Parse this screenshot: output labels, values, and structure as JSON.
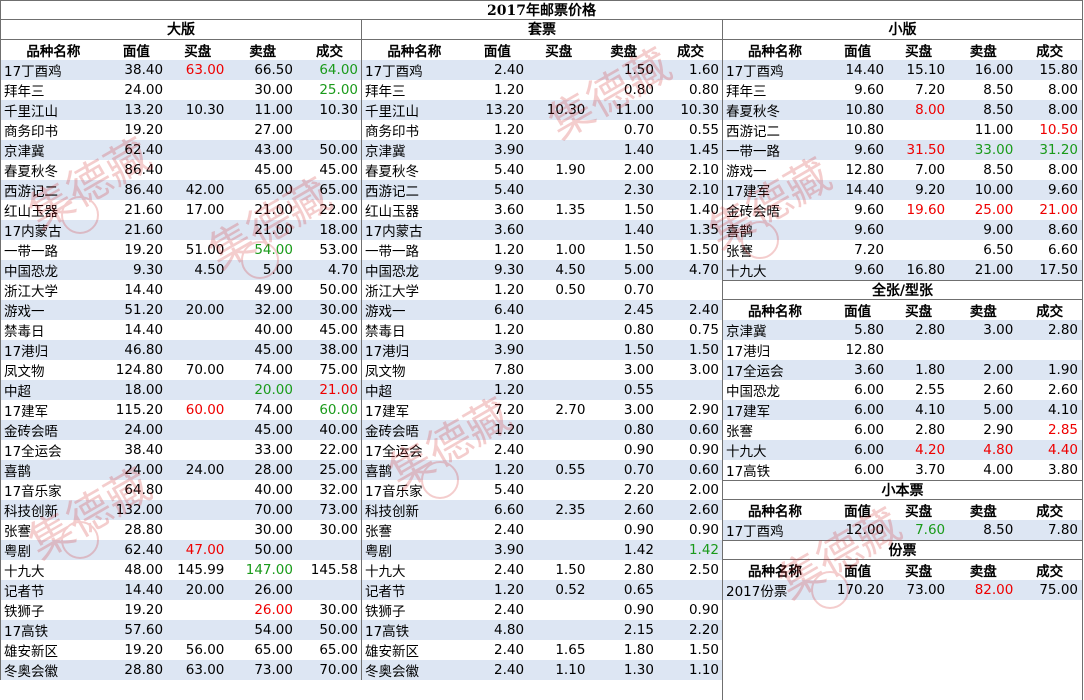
{
  "title": "2017年邮票价格",
  "headers": [
    "品种名称",
    "面值",
    "买盘",
    "卖盘",
    "成交"
  ],
  "watermark": "集德藏",
  "colors": {
    "stripe": "#dde6f3",
    "red": "#ee0000",
    "green": "#1a9a1a",
    "border": "#6f6f6f"
  },
  "sections": {
    "daban": {
      "title": "大版",
      "rows": [
        {
          "name": "17丁酉鸡",
          "face": "38.40",
          "bid": "63.00",
          "ask": "66.50",
          "deal": "64.00",
          "bidColor": "red",
          "dealColor": "green"
        },
        {
          "name": "拜年三",
          "face": "24.00",
          "bid": "",
          "ask": "30.00",
          "deal": "25.00",
          "dealColor": "green"
        },
        {
          "name": "千里江山",
          "face": "13.20",
          "bid": "10.30",
          "ask": "11.00",
          "deal": "10.30"
        },
        {
          "name": "商务印书",
          "face": "19.20",
          "bid": "",
          "ask": "27.00",
          "deal": ""
        },
        {
          "name": "京津冀",
          "face": "62.40",
          "bid": "",
          "ask": "43.00",
          "deal": "50.00"
        },
        {
          "name": "春夏秋冬",
          "face": "86.40",
          "bid": "",
          "ask": "45.00",
          "deal": "45.00"
        },
        {
          "name": "西游记二",
          "face": "86.40",
          "bid": "42.00",
          "ask": "65.00",
          "deal": "65.00"
        },
        {
          "name": "红山玉器",
          "face": "21.60",
          "bid": "17.00",
          "ask": "21.00",
          "deal": "22.00"
        },
        {
          "name": "17内蒙古",
          "face": "21.60",
          "bid": "",
          "ask": "21.00",
          "deal": "18.00"
        },
        {
          "name": "一带一路",
          "face": "19.20",
          "bid": "51.00",
          "ask": "54.00",
          "deal": "53.00",
          "askColor": "green"
        },
        {
          "name": "中国恐龙",
          "face": "9.30",
          "bid": "4.50",
          "ask": "5.00",
          "deal": "4.70"
        },
        {
          "name": "浙江大学",
          "face": "14.40",
          "bid": "",
          "ask": "49.00",
          "deal": "50.00"
        },
        {
          "name": "游戏一",
          "face": "51.20",
          "bid": "20.00",
          "ask": "32.00",
          "deal": "30.00"
        },
        {
          "name": "禁毒日",
          "face": "14.40",
          "bid": "",
          "ask": "40.00",
          "deal": "45.00"
        },
        {
          "name": "17港归",
          "face": "46.80",
          "bid": "",
          "ask": "45.00",
          "deal": "38.00"
        },
        {
          "name": "凤文物",
          "face": "124.80",
          "bid": "70.00",
          "ask": "74.00",
          "deal": "75.00"
        },
        {
          "name": "中超",
          "face": "18.00",
          "bid": "",
          "ask": "20.00",
          "deal": "21.00",
          "askColor": "green",
          "dealColor": "red"
        },
        {
          "name": "17建军",
          "face": "115.20",
          "bid": "60.00",
          "ask": "74.00",
          "deal": "60.00",
          "bidColor": "red",
          "dealColor": "green"
        },
        {
          "name": "金砖会晤",
          "face": "24.00",
          "bid": "",
          "ask": "45.00",
          "deal": "40.00"
        },
        {
          "name": "17全运会",
          "face": "38.40",
          "bid": "",
          "ask": "33.00",
          "deal": "22.00"
        },
        {
          "name": "喜鹊",
          "face": "24.00",
          "bid": "24.00",
          "ask": "28.00",
          "deal": "25.00"
        },
        {
          "name": "17音乐家",
          "face": "64.80",
          "bid": "",
          "ask": "40.00",
          "deal": "32.00"
        },
        {
          "name": "科技创新",
          "face": "132.00",
          "bid": "",
          "ask": "70.00",
          "deal": "73.00"
        },
        {
          "name": "张謇",
          "face": "28.80",
          "bid": "",
          "ask": "30.00",
          "deal": "30.00"
        },
        {
          "name": "粤剧",
          "face": "62.40",
          "bid": "47.00",
          "ask": "50.00",
          "deal": "",
          "bidColor": "red"
        },
        {
          "name": "十九大",
          "face": "48.00",
          "bid": "145.99",
          "ask": "147.00",
          "deal": "145.58",
          "askColor": "green"
        },
        {
          "name": "记者节",
          "face": "14.40",
          "bid": "20.00",
          "ask": "26.00",
          "deal": ""
        },
        {
          "name": "铁狮子",
          "face": "19.20",
          "bid": "",
          "ask": "26.00",
          "deal": "30.00",
          "askColor": "red"
        },
        {
          "name": "17高铁",
          "face": "57.60",
          "bid": "",
          "ask": "54.00",
          "deal": "50.00"
        },
        {
          "name": "雄安新区",
          "face": "19.20",
          "bid": "56.00",
          "ask": "65.00",
          "deal": "65.00"
        },
        {
          "name": "冬奥会徽",
          "face": "28.80",
          "bid": "63.00",
          "ask": "73.00",
          "deal": "70.00"
        }
      ]
    },
    "taopiao": {
      "title": "套票",
      "rows": [
        {
          "name": "17丁酉鸡",
          "face": "2.40",
          "bid": "",
          "ask": "1.50",
          "deal": "1.60"
        },
        {
          "name": "拜年三",
          "face": "1.20",
          "bid": "",
          "ask": "0.80",
          "deal": "0.80"
        },
        {
          "name": "千里江山",
          "face": "13.20",
          "bid": "10.30",
          "ask": "11.00",
          "deal": "10.30"
        },
        {
          "name": "商务印书",
          "face": "1.20",
          "bid": "",
          "ask": "0.70",
          "deal": "0.55"
        },
        {
          "name": "京津冀",
          "face": "3.90",
          "bid": "",
          "ask": "1.40",
          "deal": "1.45"
        },
        {
          "name": "春夏秋冬",
          "face": "5.40",
          "bid": "1.90",
          "ask": "2.00",
          "deal": "2.10"
        },
        {
          "name": "西游记二",
          "face": "5.40",
          "bid": "",
          "ask": "2.30",
          "deal": "2.10"
        },
        {
          "name": "红山玉器",
          "face": "3.60",
          "bid": "1.35",
          "ask": "1.50",
          "deal": "1.40"
        },
        {
          "name": "17内蒙古",
          "face": "3.60",
          "bid": "",
          "ask": "1.40",
          "deal": "1.35"
        },
        {
          "name": "一带一路",
          "face": "1.20",
          "bid": "1.00",
          "ask": "1.50",
          "deal": "1.50"
        },
        {
          "name": "中国恐龙",
          "face": "9.30",
          "bid": "4.50",
          "ask": "5.00",
          "deal": "4.70"
        },
        {
          "name": "浙江大学",
          "face": "1.20",
          "bid": "0.50",
          "ask": "0.70",
          "deal": ""
        },
        {
          "name": "游戏一",
          "face": "6.40",
          "bid": "",
          "ask": "2.45",
          "deal": "2.40"
        },
        {
          "name": "禁毒日",
          "face": "1.20",
          "bid": "",
          "ask": "0.80",
          "deal": "0.75"
        },
        {
          "name": "17港归",
          "face": "3.90",
          "bid": "",
          "ask": "1.50",
          "deal": "1.50"
        },
        {
          "name": "凤文物",
          "face": "7.80",
          "bid": "",
          "ask": "3.00",
          "deal": "3.00"
        },
        {
          "name": "中超",
          "face": "1.20",
          "bid": "",
          "ask": "0.55",
          "deal": ""
        },
        {
          "name": "17建军",
          "face": "7.20",
          "bid": "2.70",
          "ask": "3.00",
          "deal": "2.90"
        },
        {
          "name": "金砖会晤",
          "face": "1.20",
          "bid": "",
          "ask": "0.80",
          "deal": "0.60"
        },
        {
          "name": "17全运会",
          "face": "2.40",
          "bid": "",
          "ask": "0.90",
          "deal": "0.90"
        },
        {
          "name": "喜鹊",
          "face": "1.20",
          "bid": "0.55",
          "ask": "0.70",
          "deal": "0.60"
        },
        {
          "name": "17音乐家",
          "face": "5.40",
          "bid": "",
          "ask": "2.20",
          "deal": "2.00"
        },
        {
          "name": "科技创新",
          "face": "6.60",
          "bid": "2.35",
          "ask": "2.60",
          "deal": "2.60"
        },
        {
          "name": "张謇",
          "face": "2.40",
          "bid": "",
          "ask": "0.90",
          "deal": "0.90"
        },
        {
          "name": "粤剧",
          "face": "3.90",
          "bid": "",
          "ask": "1.42",
          "deal": "1.42",
          "dealColor": "green"
        },
        {
          "name": "十九大",
          "face": "2.40",
          "bid": "1.50",
          "ask": "2.80",
          "deal": "2.50"
        },
        {
          "name": "记者节",
          "face": "1.20",
          "bid": "0.52",
          "ask": "0.65",
          "deal": ""
        },
        {
          "name": "铁狮子",
          "face": "2.40",
          "bid": "",
          "ask": "0.90",
          "deal": "0.90"
        },
        {
          "name": "17高铁",
          "face": "4.80",
          "bid": "",
          "ask": "2.15",
          "deal": "2.20"
        },
        {
          "name": "雄安新区",
          "face": "2.40",
          "bid": "1.65",
          "ask": "1.80",
          "deal": "1.50"
        },
        {
          "name": "冬奥会徽",
          "face": "2.40",
          "bid": "1.10",
          "ask": "1.30",
          "deal": "1.10"
        }
      ]
    },
    "xiaoban": {
      "title": "小版",
      "rows": [
        {
          "name": "17丁酉鸡",
          "face": "14.40",
          "bid": "15.10",
          "ask": "16.00",
          "deal": "15.80"
        },
        {
          "name": "拜年三",
          "face": "9.60",
          "bid": "7.20",
          "ask": "8.50",
          "deal": "8.00"
        },
        {
          "name": "春夏秋冬",
          "face": "10.80",
          "bid": "8.00",
          "ask": "8.50",
          "deal": "8.00",
          "bidColor": "red"
        },
        {
          "name": "西游记二",
          "face": "10.80",
          "bid": "",
          "ask": "11.00",
          "deal": "10.50",
          "dealColor": "red"
        },
        {
          "name": "一带一路",
          "face": "9.60",
          "bid": "31.50",
          "ask": "33.00",
          "deal": "31.20",
          "bidColor": "red",
          "askColor": "green",
          "dealColor": "green"
        },
        {
          "name": "游戏一",
          "face": "12.80",
          "bid": "7.00",
          "ask": "8.50",
          "deal": "8.00"
        },
        {
          "name": "17建军",
          "face": "14.40",
          "bid": "9.20",
          "ask": "10.00",
          "deal": "9.60"
        },
        {
          "name": "金砖会晤",
          "face": "9.60",
          "bid": "19.60",
          "ask": "25.00",
          "deal": "21.00",
          "bidColor": "red",
          "askColor": "red",
          "dealColor": "red"
        },
        {
          "name": "喜鹊",
          "face": "9.60",
          "bid": "",
          "ask": "9.00",
          "deal": "8.60"
        },
        {
          "name": "张謇",
          "face": "7.20",
          "bid": "",
          "ask": "6.50",
          "deal": "6.60"
        },
        {
          "name": "十九大",
          "face": "9.60",
          "bid": "16.80",
          "ask": "21.00",
          "deal": "17.50"
        }
      ]
    },
    "quanzhang": {
      "title": "全张/型张",
      "rows": [
        {
          "name": "京津冀",
          "face": "5.80",
          "bid": "2.80",
          "ask": "3.00",
          "deal": "2.80"
        },
        {
          "name": "17港归",
          "face": "12.80",
          "bid": "",
          "ask": "",
          "deal": ""
        },
        {
          "name": "17全运会",
          "face": "3.60",
          "bid": "1.80",
          "ask": "2.00",
          "deal": "1.90"
        },
        {
          "name": "中国恐龙",
          "face": "6.00",
          "bid": "2.55",
          "ask": "2.60",
          "deal": "2.60"
        },
        {
          "name": "17建军",
          "face": "6.00",
          "bid": "4.10",
          "ask": "5.00",
          "deal": "4.10"
        },
        {
          "name": "张謇",
          "face": "6.00",
          "bid": "2.80",
          "ask": "2.90",
          "deal": "2.85",
          "dealColor": "red"
        },
        {
          "name": "十九大",
          "face": "6.00",
          "bid": "4.20",
          "ask": "4.80",
          "deal": "4.40",
          "bidColor": "red",
          "askColor": "red",
          "dealColor": "red"
        },
        {
          "name": "17高铁",
          "face": "6.00",
          "bid": "3.70",
          "ask": "4.00",
          "deal": "3.80"
        }
      ]
    },
    "xiaobenpiao": {
      "title": "小本票",
      "rows": [
        {
          "name": "17丁酉鸡",
          "face": "12.00",
          "bid": "7.60",
          "ask": "8.50",
          "deal": "7.80",
          "bidColor": "green"
        }
      ]
    },
    "fenpiao": {
      "title": "份票",
      "rows": [
        {
          "name": "2017份票",
          "face": "170.20",
          "bid": "73.00",
          "ask": "82.00",
          "deal": "75.00",
          "askColor": "red"
        }
      ]
    }
  }
}
